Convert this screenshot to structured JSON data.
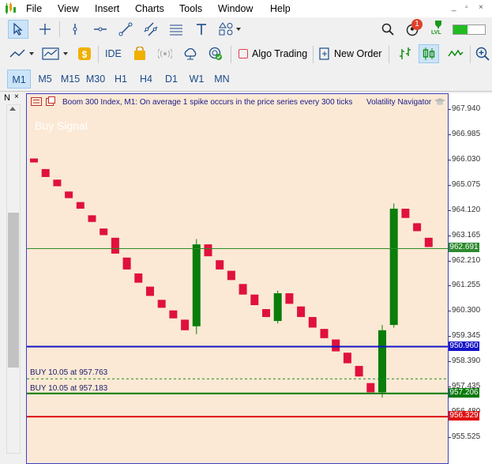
{
  "menu": [
    "File",
    "View",
    "Insert",
    "Charts",
    "Tools",
    "Window",
    "Help"
  ],
  "window_controls": [
    "_",
    "▫",
    "×"
  ],
  "notification_count": "1",
  "lvl_label": "LVL",
  "toolbar2": {
    "ide_label": "IDE",
    "algo_trading_label": "Algo Trading",
    "new_order_label": "New Order"
  },
  "timeframes": [
    "M1",
    "M5",
    "M15",
    "M30",
    "H1",
    "H4",
    "D1",
    "W1",
    "MN"
  ],
  "active_timeframe": "M1",
  "left_panel_tab": "N",
  "chart": {
    "symbol_line": "Boom 300 Index, M1:  On average 1 spike occurs in the price series every 300 ticks",
    "indicator_name": "Volatility Navigator",
    "buy_signal_text": "Buy Signal",
    "order_lines": [
      {
        "label": "BUY 10.05 at 957.763",
        "price": 957.763,
        "color": "#1f8a1f",
        "style": "dashed"
      },
      {
        "label": "BUY 10.05 at 957.183",
        "price": 957.206,
        "color": "#0a7a0a",
        "style": "solid"
      }
    ],
    "hlines": [
      {
        "price": 962.691,
        "color": "#2e8b2e",
        "width": 1,
        "tag": "962.691"
      },
      {
        "price": 950.96,
        "tag": "950.960",
        "color": "#1515c8",
        "width": 2,
        "y_override": 958.98
      },
      {
        "price": 956.329,
        "color": "#e01010",
        "width": 2,
        "tag": "956.329"
      }
    ],
    "price_labels": [
      "967.940",
      "966.985",
      "966.030",
      "965.075",
      "964.120",
      "963.165",
      "962.210",
      "961.255",
      "960.300",
      "959.345",
      "958.390",
      "957.435",
      "956.480",
      "955.525"
    ],
    "colors": {
      "bull": "#0a7d0a",
      "bear": "#e0113d",
      "background": "#fbe9d5",
      "frame": "#3f3fc8"
    }
  },
  "chart_data": {
    "type": "candlestick",
    "y_axis_ticks": [
      967.94,
      966.985,
      966.03,
      965.075,
      964.12,
      963.165,
      962.21,
      961.255,
      960.3,
      959.345,
      958.39,
      957.435,
      956.48,
      955.525
    ],
    "candles": [
      {
        "o": 966.1,
        "h": 966.1,
        "l": 965.95,
        "c": 965.95
      },
      {
        "o": 965.7,
        "h": 965.7,
        "l": 965.4,
        "c": 965.4
      },
      {
        "o": 965.3,
        "h": 965.3,
        "l": 965.05,
        "c": 965.05
      },
      {
        "o": 964.85,
        "h": 964.85,
        "l": 964.6,
        "c": 964.6
      },
      {
        "o": 964.45,
        "h": 964.45,
        "l": 964.2,
        "c": 964.2
      },
      {
        "o": 963.95,
        "h": 963.95,
        "l": 963.7,
        "c": 963.7
      },
      {
        "o": 963.45,
        "h": 963.45,
        "l": 963.2,
        "c": 963.2
      },
      {
        "o": 963.1,
        "h": 963.1,
        "l": 962.5,
        "c": 962.5
      },
      {
        "o": 962.35,
        "h": 962.35,
        "l": 961.9,
        "c": 961.9
      },
      {
        "o": 961.75,
        "h": 961.75,
        "l": 961.4,
        "c": 961.4
      },
      {
        "o": 961.25,
        "h": 961.25,
        "l": 960.9,
        "c": 960.9
      },
      {
        "o": 960.75,
        "h": 960.75,
        "l": 960.45,
        "c": 960.45
      },
      {
        "o": 960.35,
        "h": 960.35,
        "l": 960.05,
        "c": 960.05
      },
      {
        "o": 960.0,
        "h": 960.0,
        "l": 959.6,
        "c": 959.6
      },
      {
        "o": 959.75,
        "h": 963.05,
        "l": 959.45,
        "c": 962.85
      },
      {
        "o": 962.85,
        "h": 962.85,
        "l": 962.4,
        "c": 962.4
      },
      {
        "o": 962.25,
        "h": 962.25,
        "l": 961.9,
        "c": 961.9
      },
      {
        "o": 961.85,
        "h": 961.85,
        "l": 961.5,
        "c": 961.5
      },
      {
        "o": 961.35,
        "h": 961.35,
        "l": 960.95,
        "c": 960.95
      },
      {
        "o": 960.95,
        "h": 960.95,
        "l": 960.55,
        "c": 960.55
      },
      {
        "o": 960.4,
        "h": 960.4,
        "l": 960.1,
        "c": 960.1
      },
      {
        "o": 959.95,
        "h": 961.1,
        "l": 959.85,
        "c": 961.0
      },
      {
        "o": 961.0,
        "h": 961.0,
        "l": 960.6,
        "c": 960.6
      },
      {
        "o": 960.5,
        "h": 960.5,
        "l": 960.1,
        "c": 960.1
      },
      {
        "o": 960.1,
        "h": 960.1,
        "l": 959.7,
        "c": 959.7
      },
      {
        "o": 959.65,
        "h": 959.65,
        "l": 959.3,
        "c": 959.3
      },
      {
        "o": 959.25,
        "h": 959.25,
        "l": 958.8,
        "c": 958.8
      },
      {
        "o": 958.75,
        "h": 958.75,
        "l": 958.35,
        "c": 958.35
      },
      {
        "o": 958.25,
        "h": 958.25,
        "l": 957.85,
        "c": 957.85
      },
      {
        "o": 957.6,
        "h": 957.6,
        "l": 957.25,
        "c": 957.25
      },
      {
        "o": 957.25,
        "h": 959.8,
        "l": 957.05,
        "c": 959.6
      },
      {
        "o": 959.8,
        "h": 964.4,
        "l": 959.7,
        "c": 964.2
      },
      {
        "o": 964.2,
        "h": 964.2,
        "l": 963.85,
        "c": 963.85
      },
      {
        "o": 963.65,
        "h": 963.65,
        "l": 963.35,
        "c": 963.35
      },
      {
        "o": 963.1,
        "h": 963.1,
        "l": 962.75,
        "c": 962.75
      }
    ]
  }
}
